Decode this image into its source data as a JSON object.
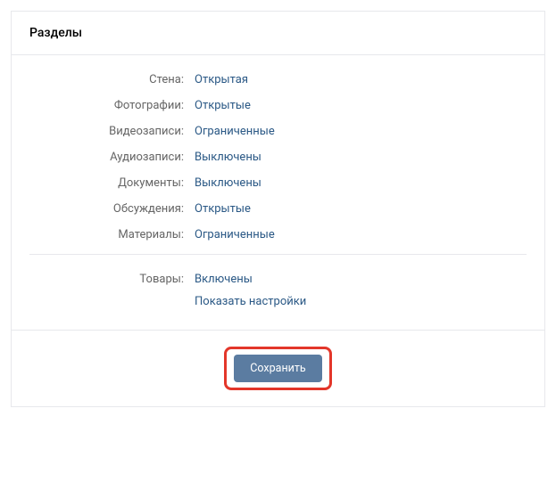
{
  "header": {
    "title": "Разделы"
  },
  "sections": [
    {
      "label": "Стена:",
      "value": "Открытая"
    },
    {
      "label": "Фотографии:",
      "value": "Открытые"
    },
    {
      "label": "Видеозаписи:",
      "value": "Ограниченные"
    },
    {
      "label": "Аудиозаписи:",
      "value": "Выключены"
    },
    {
      "label": "Документы:",
      "value": "Выключены"
    },
    {
      "label": "Обсуждения:",
      "value": "Открытые"
    },
    {
      "label": "Материалы:",
      "value": "Ограниченные"
    }
  ],
  "goods": {
    "label": "Товары:",
    "value": "Включены",
    "settings_link": "Показать настройки"
  },
  "footer": {
    "save_label": "Сохранить"
  },
  "highlight": {
    "color": "#e3362a"
  }
}
